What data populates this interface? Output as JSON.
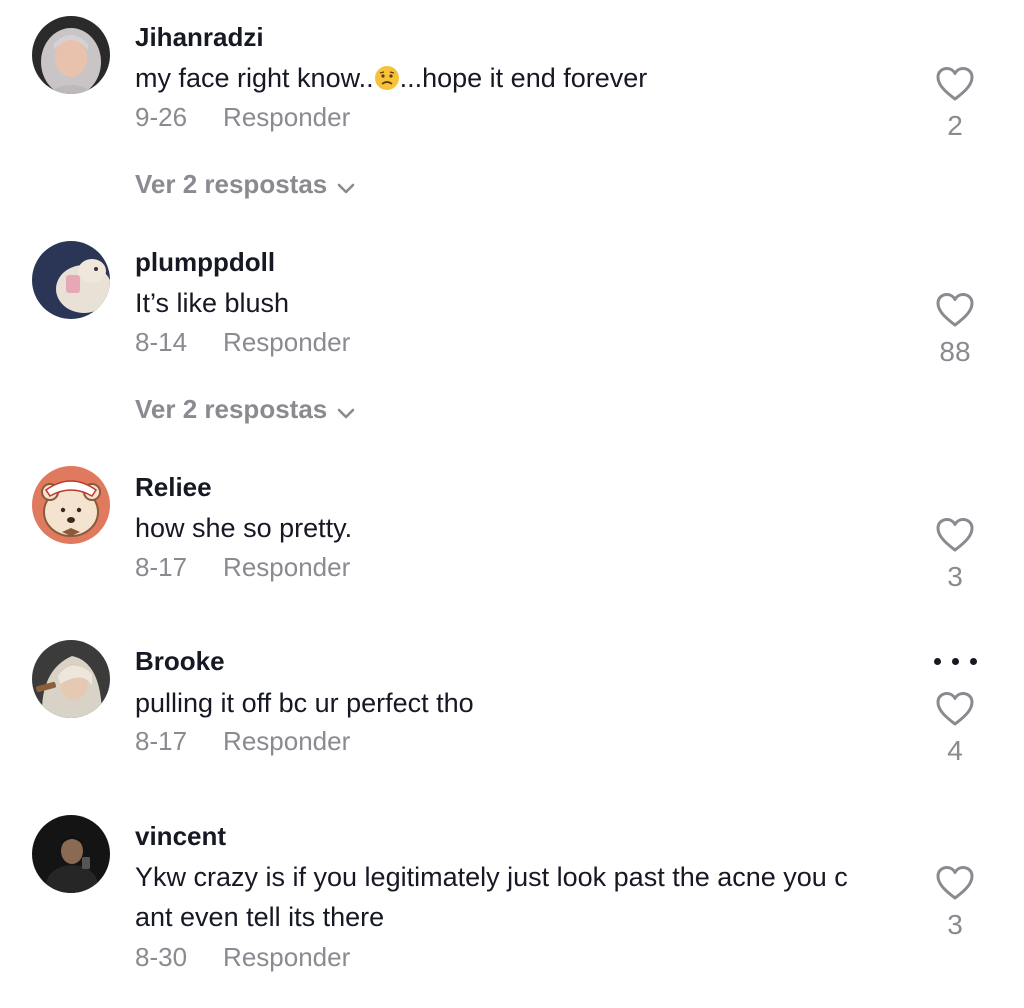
{
  "comments": [
    {
      "username": "Jihanradzi",
      "text_before": "my face right know..",
      "emoji": "worried-face-emoji",
      "text_after": "...hope it end forever",
      "date": "9-26",
      "reply_label": "Responder",
      "likes": "2",
      "view_replies": "Ver 2 respostas"
    },
    {
      "username": "plumppdoll",
      "text": "It’s like blush",
      "date": "8-14",
      "reply_label": "Responder",
      "likes": "88",
      "view_replies": "Ver 2 respostas"
    },
    {
      "username": "Reliee",
      "text": "how she so pretty.",
      "date": "8-17",
      "reply_label": "Responder",
      "likes": "3"
    },
    {
      "username": "Brooke",
      "text": "pulling it off bc ur perfect tho",
      "date": "8-17",
      "reply_label": "Responder",
      "likes": "4"
    },
    {
      "username": "vincent",
      "text_line1": "Ykw crazy is if you legitimately just look past the acne you c",
      "text_line2": "ant even tell its there",
      "date": "8-30",
      "reply_label": "Responder",
      "likes": "3"
    }
  ],
  "icons": {
    "like": "heart-outline-icon",
    "more": "more-options-icon",
    "expand": "chevron-down-icon"
  },
  "colors": {
    "primary_text": "#161823",
    "secondary_text": "#8a8b91",
    "background": "#ffffff"
  }
}
